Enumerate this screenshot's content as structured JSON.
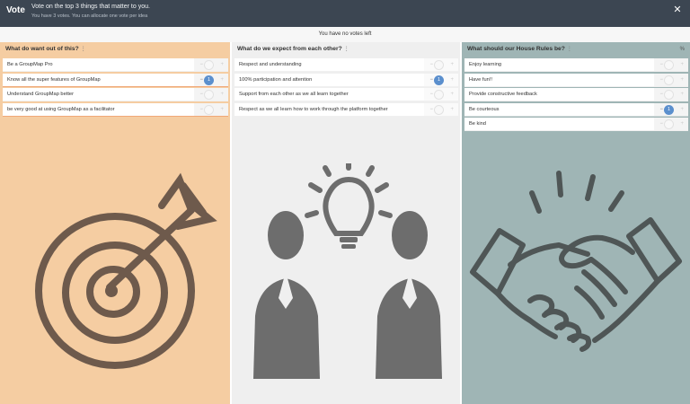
{
  "header": {
    "title": "Vote",
    "instruction": "Vote on the top 3 things that matter to you.",
    "sub": "You have 3 votes.  You can allocate one vote per idea",
    "close_icon": "close-icon"
  },
  "status": {
    "text": "You have no votes left"
  },
  "columns": [
    {
      "title": "What do want out of this?",
      "info_icon": "info-icon",
      "illustration": "target-with-arrow-illustration",
      "items": [
        {
          "label": "Be a GroupMap Pro",
          "votes": ""
        },
        {
          "label": "Know all the super features of GroupMap",
          "votes": "1"
        },
        {
          "label": "Understand GroupMap better",
          "votes": ""
        },
        {
          "label": "be very good at using GroupMap as a facilitator",
          "votes": ""
        }
      ]
    },
    {
      "title": "What do we expect from each other?",
      "info_icon": "info-icon",
      "illustration": "two-people-lightbulb-illustration",
      "items": [
        {
          "label": "Respect and understanding",
          "votes": ""
        },
        {
          "label": "100% participation and attention",
          "votes": "1"
        },
        {
          "label": "Support from each other as we all learn together",
          "votes": ""
        },
        {
          "label": "Respect as we all learn how to work through the platform together",
          "votes": ""
        }
      ]
    },
    {
      "title": "What should our House Rules be?",
      "info_icon": "info-icon",
      "corner": "%",
      "illustration": "handshake-illustration",
      "items": [
        {
          "label": "Enjoy learning",
          "votes": ""
        },
        {
          "label": "Have fun!!",
          "votes": ""
        },
        {
          "label": "Provide constructive feedback",
          "votes": ""
        },
        {
          "label": "Be courteous",
          "votes": "1"
        },
        {
          "label": "Be kind",
          "votes": ""
        }
      ]
    }
  ],
  "controls": {
    "minus": "−",
    "plus": "+"
  },
  "colors": {
    "topbar": "#3c4652",
    "column1": "#f5cda2",
    "column2": "#efefef",
    "column3": "#9fb5b5",
    "vote_badge": "#5b8fcd",
    "illustration_brown": "#6e5a4c",
    "illustration_gray": "#6d6d6d",
    "illustration_dark": "#4f5656"
  }
}
